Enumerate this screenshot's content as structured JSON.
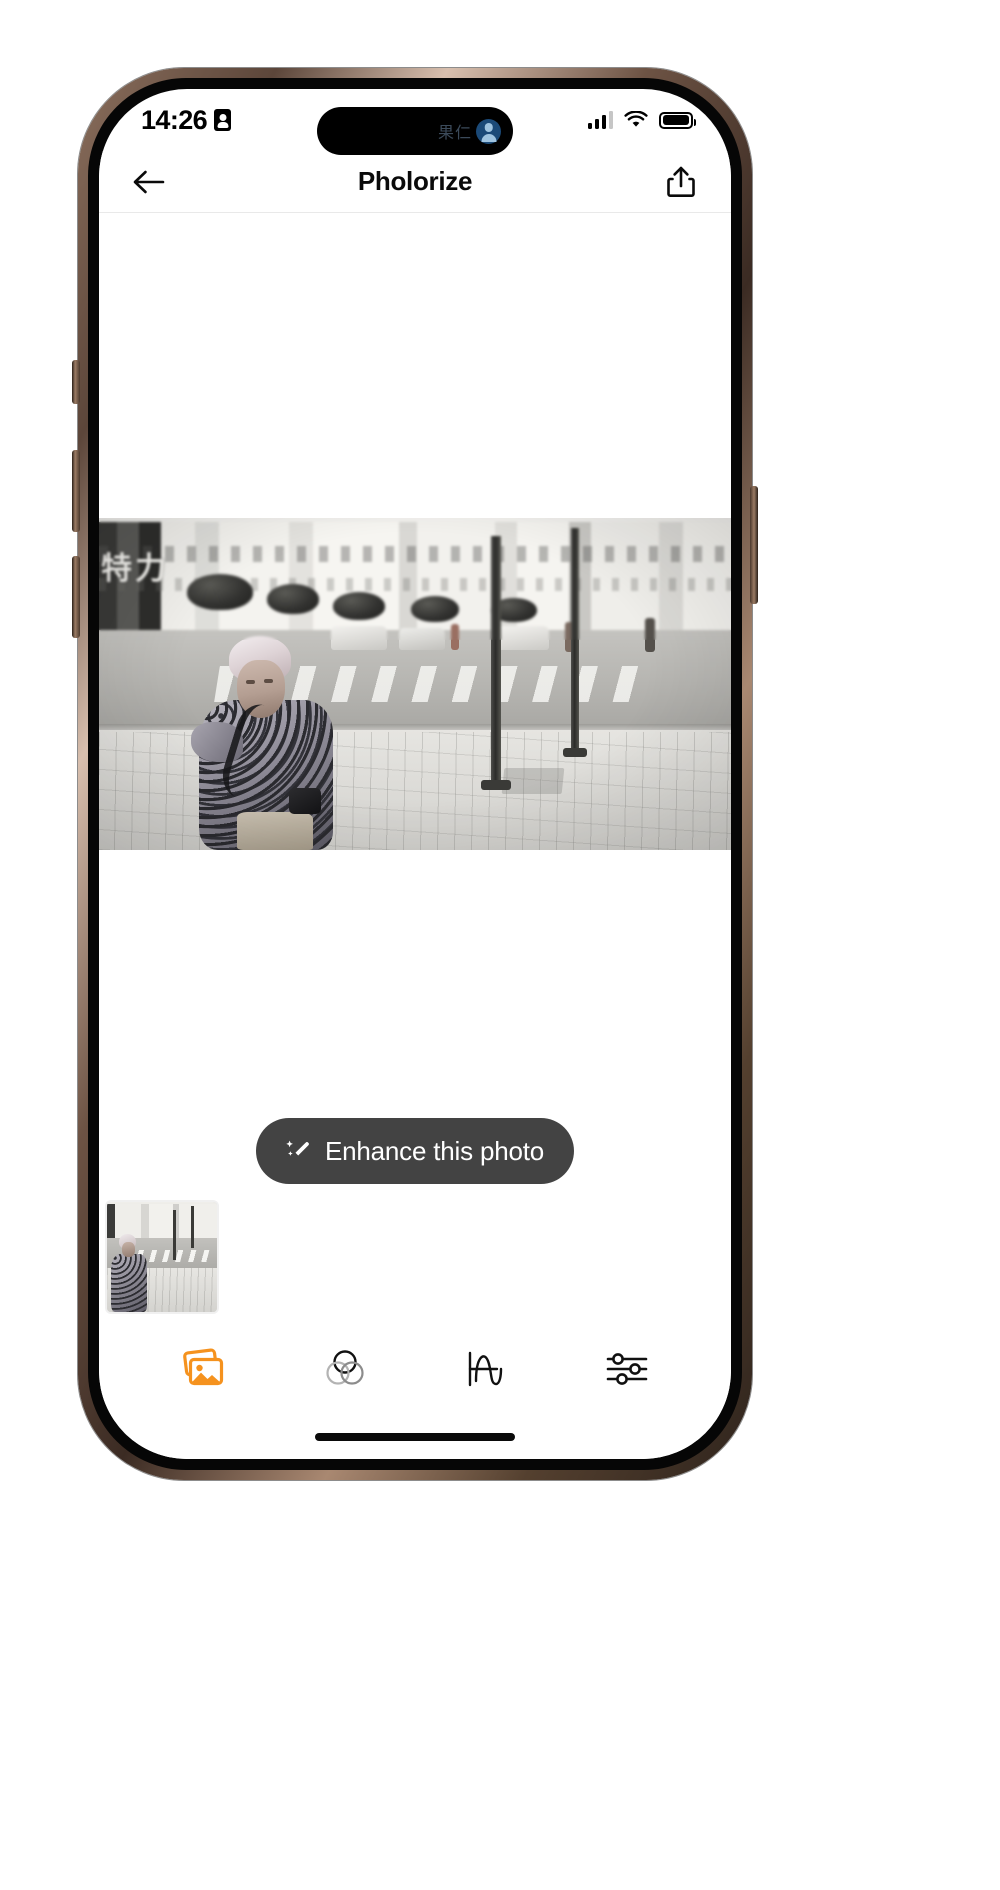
{
  "device": {
    "type": "iphone",
    "frame_color": "#6d5344"
  },
  "status_bar": {
    "time": "14:26",
    "recording_icon": "screen-record-icon",
    "dynamic_island": {
      "app_text": "果仁",
      "avatar_icon": "person-avatar-icon"
    },
    "signal": {
      "icon": "cellular-signal-icon",
      "bars_total": 4,
      "bars_filled": 3
    },
    "wifi": {
      "icon": "wifi-icon",
      "level": 3
    },
    "battery": {
      "icon": "battery-icon",
      "level_percent": 88
    }
  },
  "nav_bar": {
    "back_icon": "arrow-left-icon",
    "title": "Pholorize",
    "share_icon": "share-upload-icon"
  },
  "canvas": {
    "photo_alt": "street-photo-elderly-woman-crossing",
    "photo_description": "Desaturated street photograph of an elderly woman with white hair wearing a patterned jacket walking on a tiled sidewalk, city buildings and crosswalk behind her",
    "sign_text": "特力"
  },
  "enhance_button": {
    "label": "Enhance this photo",
    "icon": "magic-wand-sparkles-icon",
    "background_color": "#434343",
    "text_color": "#ffffff"
  },
  "thumbnails": [
    {
      "id": "thumb-1",
      "alt": "street-photo-thumbnail",
      "selected": true
    }
  ],
  "tab_bar": {
    "active_color": "#F5921E",
    "inactive_color": "#1a1a1a",
    "items": [
      {
        "id": "photos",
        "icon": "photo-stack-icon",
        "active": true
      },
      {
        "id": "filters",
        "icon": "color-circles-icon",
        "active": false
      },
      {
        "id": "curves",
        "icon": "curve-waveform-icon",
        "active": false
      },
      {
        "id": "adjustments",
        "icon": "sliders-icon",
        "active": false
      }
    ]
  },
  "home_indicator": {
    "label": "home-indicator"
  }
}
